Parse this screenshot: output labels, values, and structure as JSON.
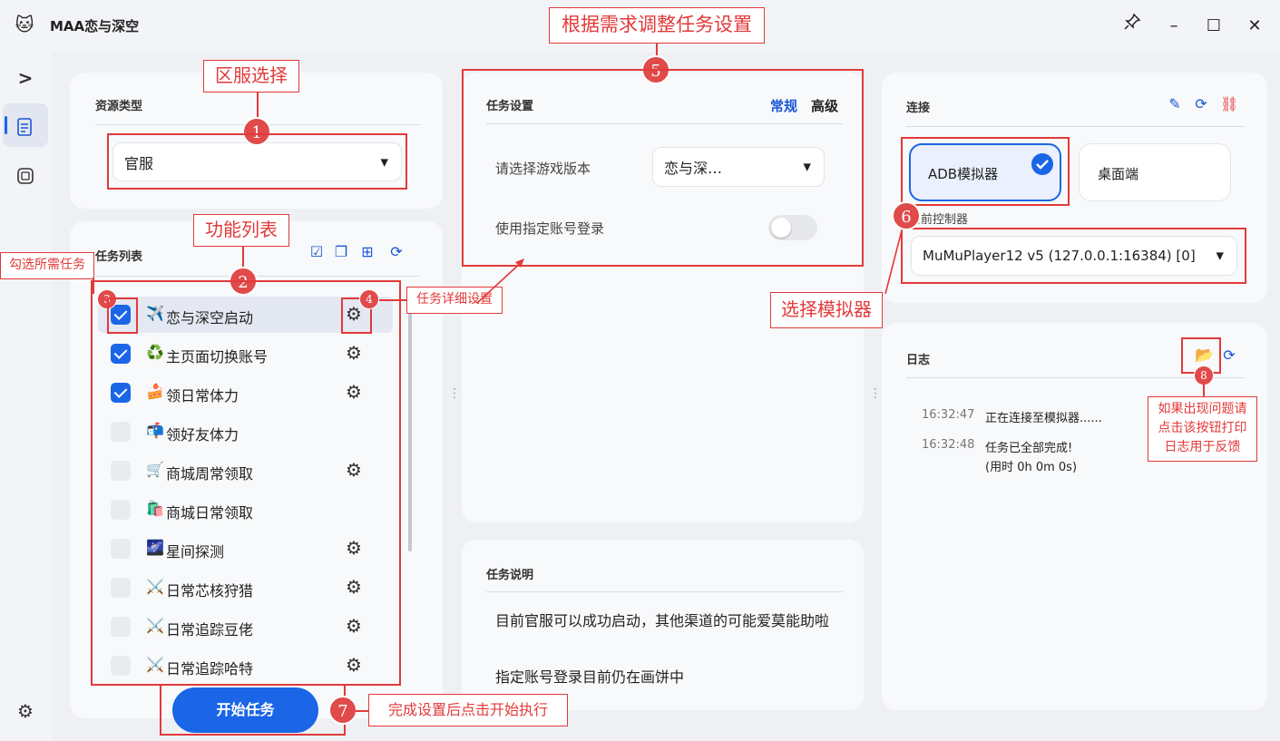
{
  "window": {
    "title": "MAA恋与深空",
    "app_icon": "cat-avatar-icon",
    "pin_icon": "pin-icon",
    "minimize_label": "–",
    "maximize_label": "☐",
    "close_label": "✕"
  },
  "rail": {
    "expand_label": ">",
    "items": [
      "task-list-icon",
      "screenshot-frame-icon"
    ],
    "settings_icon": "gear-icon"
  },
  "resource": {
    "title": "资源类型",
    "selected": "官服"
  },
  "tasks": {
    "title": "任务列表",
    "items": [
      {
        "label": "恋与深空启动",
        "emoji": "✈️",
        "checked": true,
        "gear": true
      },
      {
        "label": "主页面切换账号",
        "emoji": "♻️",
        "checked": true,
        "gear": true
      },
      {
        "label": "领日常体力",
        "emoji": "🍰",
        "checked": true,
        "gear": true
      },
      {
        "label": "领好友体力",
        "emoji": "📬",
        "checked": false,
        "gear": false
      },
      {
        "label": "商城周常领取",
        "emoji": "🛒",
        "checked": false,
        "gear": true
      },
      {
        "label": "商城日常领取",
        "emoji": "🛍️",
        "checked": false,
        "gear": false
      },
      {
        "label": "星间探测",
        "emoji": "🌌",
        "checked": false,
        "gear": true
      },
      {
        "label": "日常芯核狩猎",
        "emoji": "⚔️",
        "checked": false,
        "gear": true
      },
      {
        "label": "日常追踪豆佬",
        "emoji": "⚔️",
        "checked": false,
        "gear": true
      },
      {
        "label": "日常追踪哈特",
        "emoji": "⚔️",
        "checked": false,
        "gear": true
      }
    ],
    "start_button": "开始任务"
  },
  "settings": {
    "title": "任务设置",
    "tab_normal": "常规",
    "tab_advanced": "高级",
    "version_label": "请选择游戏版本",
    "version_value": "恋与深…",
    "login_label": "使用指定账号登录",
    "login_enabled": false
  },
  "description": {
    "title": "任务说明",
    "line1": "目前官服可以成功启动，其他渠道的可能爱莫能助啦",
    "line2": "指定账号登录目前仍在画饼中"
  },
  "connection": {
    "title": "连接",
    "adb_label": "ADB模拟器",
    "desktop_label": "桌面端",
    "controller_label": "当前控制器",
    "controller_value": "MuMuPlayer12 v5 (127.0.0.1:16384) [0]"
  },
  "log": {
    "title": "日志",
    "entries": [
      {
        "time": "16:32:47",
        "msg": "正在连接至模拟器......"
      },
      {
        "time": "16:32:48",
        "msg": "任务已全部完成!",
        "msg2": "(用时 0h 0m 0s)"
      }
    ]
  },
  "annotations": {
    "a1": "区服选择",
    "a2": "功能列表",
    "a3": "勾选所需任务",
    "a4": "任务详细设置",
    "a5": "根据需求调整任务设置",
    "a6": "选择模拟器",
    "a7": "完成设置后点击开始执行",
    "a8_line1": "如果出现问题请",
    "a8_line2": "点击该按钮打印",
    "a8_line3": "日志用于反馈",
    "n1": "1",
    "n2": "2",
    "n3": "3",
    "n4": "4",
    "n5": "5",
    "n6": "6",
    "n7": "7",
    "n8": "8"
  },
  "colors": {
    "accent": "#1a66e6",
    "annotation_red": "#e23a3a"
  }
}
